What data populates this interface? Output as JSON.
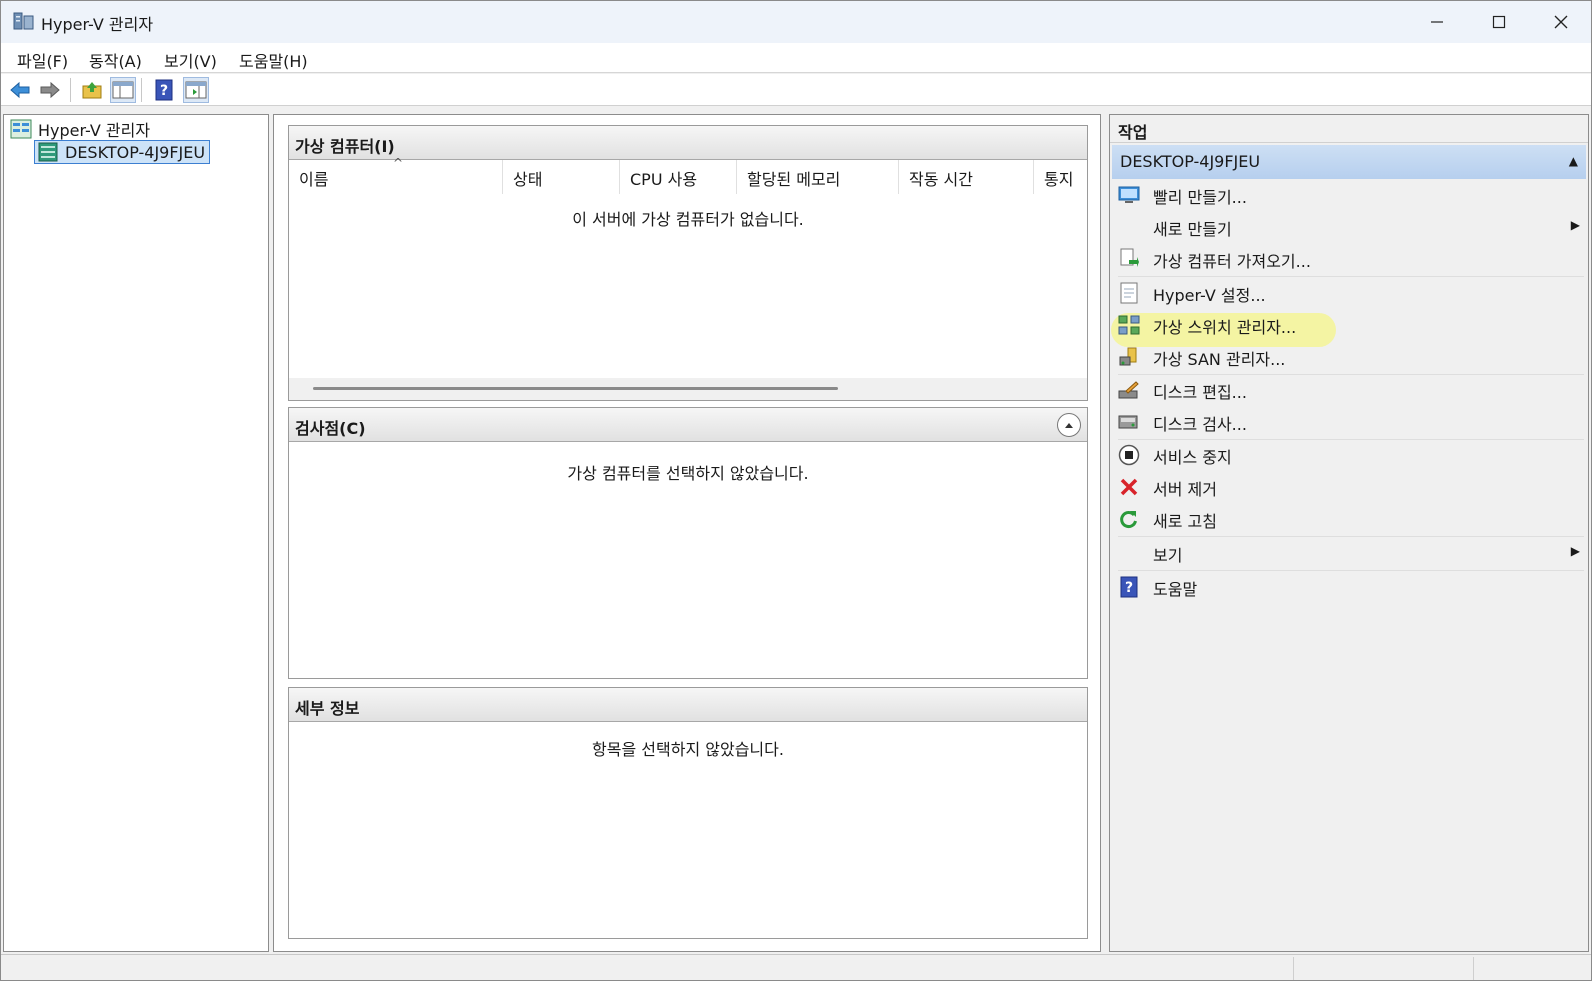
{
  "window": {
    "title": "Hyper-V 관리자",
    "minimize": "—",
    "maximize": "☐",
    "close": "✕"
  },
  "menu": {
    "items": [
      "파일(F)",
      "동작(A)",
      "보기(V)",
      "도움말(H)"
    ]
  },
  "toolbar": {
    "buttons": [
      "back-icon",
      "forward-icon",
      "up-folder-icon",
      "show-hide-console-tree-icon",
      "help-icon",
      "show-hide-action-pane-icon"
    ]
  },
  "tree": {
    "root": "Hyper-V 관리자",
    "server": "DESKTOP-4J9FJEU"
  },
  "vm_panel": {
    "title": "가상 컴퓨터(I)",
    "columns": [
      "이름",
      "상태",
      "CPU 사용",
      "할당된 메모리",
      "작동 시간",
      "통지"
    ],
    "sort_indicator": "^",
    "empty_message": "이 서버에 가상 컴퓨터가 없습니다."
  },
  "checkpoint_panel": {
    "title": "검사점(C)",
    "empty_message": "가상 컴퓨터를 선택하지 않았습니다."
  },
  "details_panel": {
    "title": "세부 정보",
    "empty_message": "항목을 선택하지 않았습니다."
  },
  "actions": {
    "title": "작업",
    "group": "DESKTOP-4J9FJEU",
    "items": [
      {
        "label": "빨리 만들기...",
        "icon": "quick-create-icon"
      },
      {
        "label": "새로 만들기",
        "icon": "",
        "submenu": true
      },
      {
        "label": "가상 컴퓨터 가져오기...",
        "icon": "import-vm-icon"
      },
      {
        "label": "Hyper-V 설정...",
        "icon": "settings-doc-icon"
      },
      {
        "label": "가상 스위치 관리자...",
        "icon": "virtual-switch-icon",
        "highlighted": true
      },
      {
        "label": "가상 SAN 관리자...",
        "icon": "virtual-san-icon"
      },
      {
        "label": "디스크 편집...",
        "icon": "edit-disk-icon"
      },
      {
        "label": "디스크 검사...",
        "icon": "inspect-disk-icon"
      },
      {
        "label": "서비스 중지",
        "icon": "stop-service-icon"
      },
      {
        "label": "서버 제거",
        "icon": "remove-server-icon"
      },
      {
        "label": "새로 고침",
        "icon": "refresh-icon"
      },
      {
        "label": "보기",
        "icon": "",
        "submenu": true
      },
      {
        "label": "도움말",
        "icon": "help-icon"
      }
    ],
    "highlight_color": "#f6f58a"
  },
  "colors": {
    "accent": "#3c7fd1",
    "selection": "#cde3f8",
    "group_header": "#c3d8f1"
  }
}
